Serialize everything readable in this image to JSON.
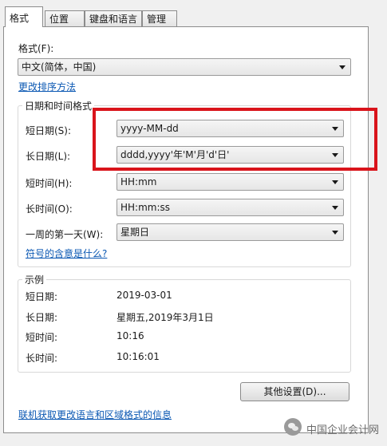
{
  "tabs": [
    "格式",
    "位置",
    "键盘和语言",
    "管理"
  ],
  "format": {
    "label": "格式(F):",
    "value": "中文(简体，中国)",
    "sort_link": "更改排序方法"
  },
  "datetime": {
    "title": "日期和时间格式",
    "rows": [
      {
        "label": "短日期(S):",
        "value": "yyyy-MM-dd"
      },
      {
        "label": "长日期(L):",
        "value": "dddd,yyyy'年'M'月'd'日'"
      },
      {
        "label": "短时间(H):",
        "value": "HH:mm"
      },
      {
        "label": "长时间(O):",
        "value": "HH:mm:ss"
      },
      {
        "label": "一周的第一天(W):",
        "value": "星期日"
      }
    ],
    "symbol_link": "符号的含意是什么?"
  },
  "examples": {
    "title": "示例",
    "rows": [
      {
        "label": "短日期:",
        "value": "2019-03-01"
      },
      {
        "label": "长日期:",
        "value": "星期五,2019年3月1日"
      },
      {
        "label": "短时间:",
        "value": "10:16"
      },
      {
        "label": "长时间:",
        "value": "10:16:01"
      }
    ]
  },
  "other_settings_button": "其他设置(D)...",
  "online_link": "联机获取更改语言和区域格式的信息",
  "watermark": "中国企业会计网",
  "highlight_color": "#d9141b",
  "link_color": "#0b58b3"
}
